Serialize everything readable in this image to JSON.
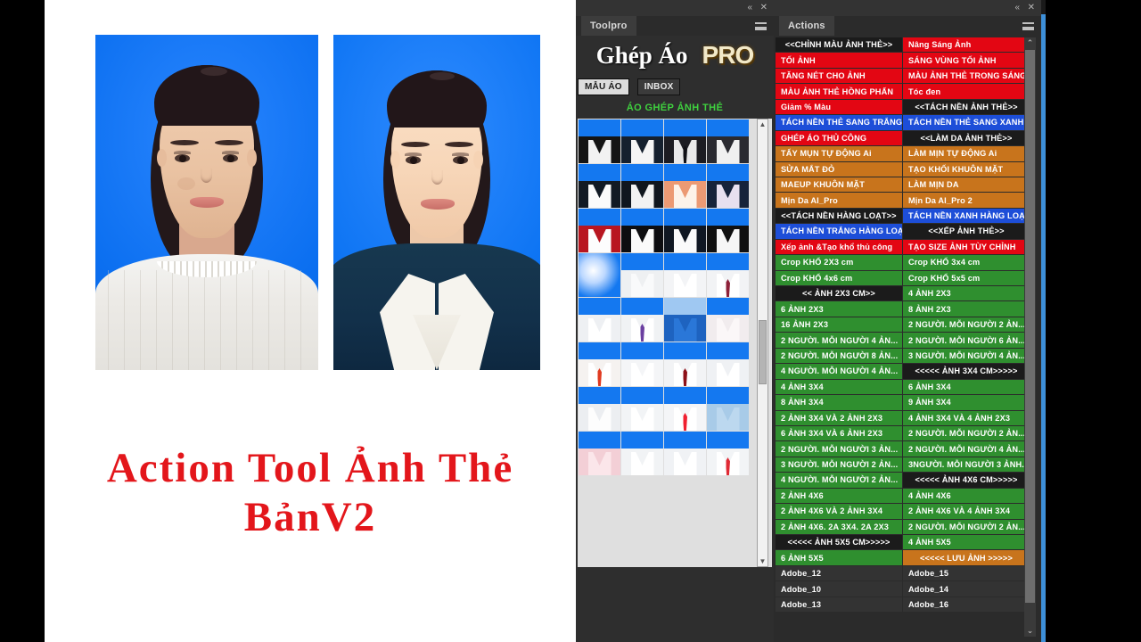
{
  "overlay": {
    "title_line1": "Action Tool Ảnh Thẻ",
    "title_line2": "BảnV2",
    "title_color": "#e3161b"
  },
  "photos": [
    {
      "name": "before-photo",
      "caption": ""
    },
    {
      "name": "after-photo",
      "caption": ""
    }
  ],
  "toolpro": {
    "tab_label": "Toolpro",
    "collapse_icon": "collapse-icon",
    "close_icon": "close-icon",
    "menu_icon": "panel-menu-icon",
    "brand_main": "Ghép Áo",
    "brand_pro": "PRO",
    "buttons": [
      {
        "label": "MẪU ÁO",
        "style": "light"
      },
      {
        "label": "INBOX",
        "style": "dark"
      }
    ],
    "section_heading": "ÁO GHÉP ẢNH THẺ",
    "heading_color": "#3fd23f",
    "scroll_up_icon": "▲",
    "scroll_down_icon": "▼",
    "thumbnails": [
      {
        "type": "suit",
        "shirt": "#141414",
        "collar": "#f2f2f2"
      },
      {
        "type": "suit",
        "shirt": "#15202e",
        "collar": "#f5f5f5"
      },
      {
        "type": "tie",
        "shirt": "#1c1c22",
        "collar": "#e9e9ea",
        "tie": "#101016"
      },
      {
        "type": "suit",
        "shirt": "#2a2a30",
        "collar": "#f0f0f0"
      },
      {
        "type": "suit",
        "shirt": "#121a24",
        "collar": "#fbfbfb"
      },
      {
        "type": "suit",
        "shirt": "#10161e",
        "collar": "#f2f2f2"
      },
      {
        "type": "suit",
        "shirt": "#ec9a74",
        "collar": "#fdf3ea"
      },
      {
        "type": "suit",
        "shirt": "#16233a",
        "collar": "#e7e0ef"
      },
      {
        "type": "suit",
        "shirt": "#b81620",
        "collar": "#fdfdfd"
      },
      {
        "type": "suit",
        "shirt": "#0d0d10",
        "collar": "#fafafa"
      },
      {
        "type": "suit",
        "shirt": "#101722",
        "collar": "#fafafa"
      },
      {
        "type": "suit",
        "shirt": "#101010",
        "collar": "#f6f6f6"
      },
      {
        "type": "glow",
        "shirt": "",
        "collar": ""
      },
      {
        "type": "shirt",
        "shirt": "#eef0f2",
        "collar": "#f9fafb"
      },
      {
        "type": "shirt",
        "shirt": "#f3f4f6",
        "collar": "#ffffff"
      },
      {
        "type": "tie",
        "shirt": "#f2f3f5",
        "collar": "#ffffff",
        "tie": "#8d2038"
      },
      {
        "type": "shirt",
        "shirt": "#eef0f3",
        "collar": "#ffffff"
      },
      {
        "type": "tie",
        "shirt": "#f0f2f4",
        "collar": "#ffffff",
        "tie": "#6b3fa0"
      },
      {
        "type": "ltblue",
        "shirt": "#1e63c0",
        "collar": "#2a77d8"
      },
      {
        "type": "shirt",
        "shirt": "#f1ecee",
        "collar": "#fbf7f8"
      },
      {
        "type": "tie",
        "shirt": "#f5f2f0",
        "collar": "#ffffff",
        "tie": "#e03a20"
      },
      {
        "type": "shirt",
        "shirt": "#f4f5f7",
        "collar": "#ffffff"
      },
      {
        "type": "tie",
        "shirt": "#f2f3f5",
        "collar": "#ffffff",
        "tie": "#8e1118"
      },
      {
        "type": "shirt",
        "shirt": "#eff1f4",
        "collar": "#ffffff"
      },
      {
        "type": "shirt",
        "shirt": "#eceef1",
        "collar": "#fdfdfd"
      },
      {
        "type": "shirt",
        "shirt": "#f2f4f6",
        "collar": "#ffffff"
      },
      {
        "type": "tie",
        "shirt": "#f4f5f7",
        "collar": "#ffffff",
        "tie": "#f02030"
      },
      {
        "type": "shirt",
        "shirt": "#a8cbe8",
        "collar": "#bcd8ef"
      },
      {
        "type": "shirt",
        "shirt": "#f3cfd6",
        "collar": "#fbe6ea"
      },
      {
        "type": "shirt",
        "shirt": "#f1f3f5",
        "collar": "#ffffff"
      },
      {
        "type": "shirt",
        "shirt": "#f0f2f5",
        "collar": "#ffffff"
      },
      {
        "type": "tie",
        "shirt": "#f2f4f6",
        "collar": "#ffffff",
        "tie": "#e02a34"
      }
    ]
  },
  "actions": {
    "tab_label": "Actions",
    "collapse_icon": "collapse-icon",
    "close_icon": "close-icon",
    "menu_icon": "panel-menu-icon",
    "scroll_up_icon": "⌃",
    "scroll_down_icon": "⌄",
    "colors": {
      "red": "#e30613",
      "black": "#1b1b1b",
      "blue": "#1d4ed8",
      "orange": "#c8741c",
      "green": "#2f8f2f",
      "dark": "#333333"
    },
    "rows": [
      [
        {
          "t": "<<CHỈNH MÀU ẢNH THẺ>>",
          "c": "black",
          "center": true
        },
        {
          "t": "Nâng Sáng Ảnh",
          "c": "red"
        }
      ],
      [
        {
          "t": "TỐI ẢNH",
          "c": "red"
        },
        {
          "t": "SÁNG VÙNG TỐI  ẢNH",
          "c": "red"
        }
      ],
      [
        {
          "t": "TĂNG NÉT CHO ẢNH",
          "c": "red"
        },
        {
          "t": "MÀU ẢNH THẺ TRONG SÁNG",
          "c": "red"
        }
      ],
      [
        {
          "t": "MÀU ẢNH THẺ HỒNG PHẤN",
          "c": "red"
        },
        {
          "t": "Tóc đen",
          "c": "red"
        }
      ],
      [
        {
          "t": "Giảm % Màu",
          "c": "red"
        },
        {
          "t": "<<TÁCH NỀN ẢNH THẺ>>",
          "c": "black",
          "center": true
        }
      ],
      [
        {
          "t": "TÁCH NỀN THẺ SANG TRẮNG",
          "c": "blue"
        },
        {
          "t": "TÁCH NỀN THẺ SANG XANH",
          "c": "blue"
        }
      ],
      [
        {
          "t": "GHÉP ÁO THỦ CÔNG",
          "c": "red"
        },
        {
          "t": "<<LÀM DA ẢNH THẺ>>",
          "c": "black",
          "center": true
        }
      ],
      [
        {
          "t": "TẨY MỤN TỰ ĐỘNG Ai",
          "c": "orange"
        },
        {
          "t": "LÀM MỊN TỰ ĐỘNG Ai",
          "c": "orange"
        }
      ],
      [
        {
          "t": "SỬA MẮT ĐỎ",
          "c": "orange"
        },
        {
          "t": "TẠO KHỐI KHUÔN MẶT",
          "c": "orange"
        }
      ],
      [
        {
          "t": "MAEUP KHUÔN MẶT",
          "c": "orange"
        },
        {
          "t": "LÀM MỊN DA",
          "c": "orange"
        }
      ],
      [
        {
          "t": "Mịn Da AI_Pro",
          "c": "orange"
        },
        {
          "t": "Mịn Da AI_Pro 2",
          "c": "orange"
        }
      ],
      [
        {
          "t": "<<TÁCH NỀN HÀNG LOẠT>>",
          "c": "black",
          "center": true
        },
        {
          "t": "TÁCH NỀN XANH HÀNG LOẠT",
          "c": "blue"
        }
      ],
      [
        {
          "t": "TÁCH NỀN TRẮNG HÀNG LOẠT",
          "c": "blue"
        },
        {
          "t": "<<XẾP ẢNH THẺ>>",
          "c": "black",
          "center": true
        }
      ],
      [
        {
          "t": "Xếp ảnh &Tạo khổ thủ công",
          "c": "red"
        },
        {
          "t": "TẠO SIZE ẢNH TÙY CHỈNH",
          "c": "red"
        }
      ],
      [
        {
          "t": "Crop KHỔ 2X3 cm",
          "c": "green"
        },
        {
          "t": "Crop KHỔ 3x4 cm",
          "c": "green"
        }
      ],
      [
        {
          "t": "Crop KHỔ 4x6 cm",
          "c": "green"
        },
        {
          "t": "Crop KHỔ 5x5 cm",
          "c": "green"
        }
      ],
      [
        {
          "t": "<< ẢNH 2X3 CM>>",
          "c": "black",
          "center": true
        },
        {
          "t": "4 ẢNH 2X3",
          "c": "green"
        }
      ],
      [
        {
          "t": "6 ẢNH 2X3",
          "c": "green"
        },
        {
          "t": "8 ẢNH 2X3",
          "c": "green"
        }
      ],
      [
        {
          "t": "16 ẢNH 2X3",
          "c": "green"
        },
        {
          "t": "2 NGƯỜI. MỖI NGƯỜI 2 ẢN...",
          "c": "green"
        }
      ],
      [
        {
          "t": "2 NGƯỜI. MỖI NGƯỜI 4 ẢN...",
          "c": "green"
        },
        {
          "t": "2 NGƯỜI. MỖI NGƯỜI 6 ẢN...",
          "c": "green"
        }
      ],
      [
        {
          "t": "2 NGƯỜI. MỖI NGƯỜI 8 ẢN...",
          "c": "green"
        },
        {
          "t": "3 NGƯỜI. MỖI NGƯỜI 4 ẢN...",
          "c": "green"
        }
      ],
      [
        {
          "t": "4 NGƯỜI. MỖI NGƯỜI 4 ẢN...",
          "c": "green"
        },
        {
          "t": "<<<<< ẢNH 3X4 CM>>>>>",
          "c": "black",
          "center": true
        }
      ],
      [
        {
          "t": "4 ẢNH 3X4",
          "c": "green"
        },
        {
          "t": "6 ẢNH 3X4",
          "c": "green"
        }
      ],
      [
        {
          "t": "8 ẢNH 3X4",
          "c": "green"
        },
        {
          "t": "9 ẢNH 3X4",
          "c": "green"
        }
      ],
      [
        {
          "t": "2 ẢNH 3X4 VÀ 2 ẢNH 2X3",
          "c": "green"
        },
        {
          "t": "4 ẢNH 3X4 VÀ 4 ẢNH 2X3",
          "c": "green"
        }
      ],
      [
        {
          "t": "6 ẢNH 3X4 VÀ 6 ẢNH 2X3",
          "c": "green"
        },
        {
          "t": "2 NGƯỜI. MỖI NGƯỜI 2 ẢN...",
          "c": "green"
        }
      ],
      [
        {
          "t": "2 NGƯỜI. MỖI NGƯỜI 3 ẢN...",
          "c": "green"
        },
        {
          "t": "2 NGƯỜI. MỖI NGƯỜI 4 ẢN...",
          "c": "green"
        }
      ],
      [
        {
          "t": "3 NGƯỜI. MỖI NGƯỜI 2 ẢN...",
          "c": "green"
        },
        {
          "t": "3NGƯỜI. MỖI NGƯỜI 3 ẢNH...",
          "c": "green"
        }
      ],
      [
        {
          "t": "4 NGƯỜI. MỖI NGƯỜI 2 ẢN...",
          "c": "green"
        },
        {
          "t": "<<<<< ẢNH 4X6 CM>>>>>",
          "c": "black",
          "center": true
        }
      ],
      [
        {
          "t": "2 ẢNH 4X6",
          "c": "green"
        },
        {
          "t": "4 ẢNH 4X6",
          "c": "green"
        }
      ],
      [
        {
          "t": "2 ẢNH 4X6 VÀ 2 ẢNH 3X4",
          "c": "green"
        },
        {
          "t": "2 ẢNH 4X6 VÀ 4 ẢNH 3X4",
          "c": "green"
        }
      ],
      [
        {
          "t": "2 ẢNH 4X6. 2A 3X4. 2A 2X3",
          "c": "green"
        },
        {
          "t": "2 NGƯỜI. MỖI NGƯỜI 2 ẢN...",
          "c": "green"
        }
      ],
      [
        {
          "t": "<<<<< ẢNH 5X5 CM>>>>>",
          "c": "black",
          "center": true
        },
        {
          "t": "4 ẢNH 5X5",
          "c": "green"
        }
      ],
      [
        {
          "t": "6 ẢNH 5X5",
          "c": "green"
        },
        {
          "t": "<<<<< LƯU ẢNH >>>>>",
          "c": "orange",
          "center": true
        }
      ],
      [
        {
          "t": "Adobe_12",
          "c": "dark"
        },
        {
          "t": "Adobe_15",
          "c": "dark"
        }
      ],
      [
        {
          "t": "Adobe_10",
          "c": "dark"
        },
        {
          "t": "Adobe_14",
          "c": "dark"
        }
      ],
      [
        {
          "t": "Adobe_13",
          "c": "dark"
        },
        {
          "t": "Adobe_16",
          "c": "dark"
        }
      ]
    ]
  }
}
